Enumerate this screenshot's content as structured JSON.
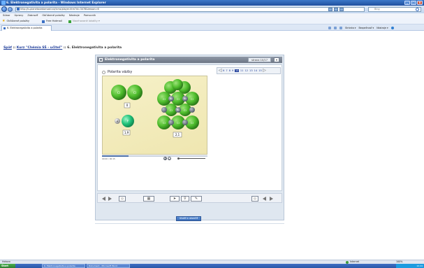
{
  "window": {
    "title": "6. Elektronegativita a polarita - Windows Internet Explorer"
  },
  "address": {
    "url": "http://is.planetavedomosti.sk/lcms/player.htm?id=3478&lesson=6",
    "search_placeholder": "Bing"
  },
  "menu": [
    "Súbor",
    "Úpravy",
    "Zobraziť",
    "Obľúbené položky",
    "Nástroje",
    "Pomocník"
  ],
  "favorites": {
    "label": "Obľúbené položky",
    "items": [
      "Free Hotmail",
      "Navrhované lokality ▾"
    ]
  },
  "tab": {
    "label": "6. Elektronegativita a polarita"
  },
  "commandbar": [
    "Stránka ▾",
    "Bezpečnosť ▾",
    "Nástroje ▾"
  ],
  "breadcrumb": {
    "back": "Späť",
    "sep1": " :: ",
    "course": "Kurz \"Chémia SŠ - učiteľ\"",
    "sep2": " :: ",
    "lesson": "6. Elektronegativita a polarita"
  },
  "lesson": {
    "header_title": "Elektronegativita a polarita",
    "step_label": "strana 10/17",
    "section_title": "Polarita väzby",
    "pager": {
      "pages": [
        "6",
        "7",
        "8",
        "9",
        "10",
        "11",
        "12",
        "13",
        "14",
        "15"
      ],
      "current": "10"
    },
    "animation": {
      "atoms": {
        "cl": "Cl",
        "h": "H",
        "f": "F",
        "na": "Na"
      },
      "values": {
        "clcl": "0",
        "hf": "1,9",
        "nacl": "2,1"
      }
    },
    "player": {
      "time": "00:00 / 00:15",
      "progress": 0.25
    }
  },
  "submit": {
    "label": "Uložiť a ukončiť"
  },
  "status": {
    "left": "Hotovo",
    "zone": "Internet",
    "zoom": "100%"
  },
  "taskbar": {
    "start": "Štart",
    "tasks": [
      "6. Elektronegativita a polarita",
      "Dokument - Microsoft Word"
    ],
    "clock": "10:24"
  },
  "colors": {
    "accent": "#1f3d9a",
    "atom_green": "#4fbd2d",
    "fluorine": "#2ecc71"
  }
}
